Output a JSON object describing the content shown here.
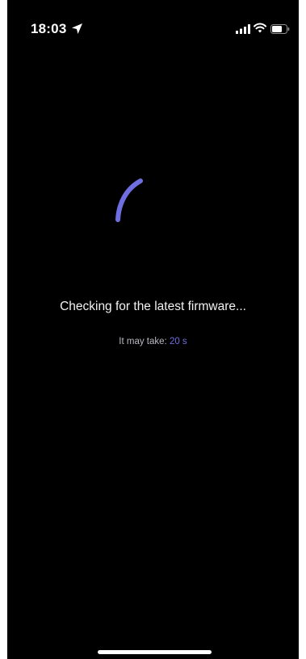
{
  "status_bar": {
    "time": "18:03",
    "icons": [
      "location-arrow-icon",
      "cellular-signal-icon",
      "wifi-icon",
      "battery-icon"
    ]
  },
  "loading": {
    "icon": "spinner-arc-icon",
    "title": "Checking for the latest firmware...",
    "subtitle_label": "It may take:",
    "subtitle_value": "20 s"
  },
  "colors": {
    "background": "#000000",
    "accent": "#6f6ee0",
    "text_primary": "#f2f2f2",
    "text_secondary": "#b9b9c4"
  }
}
